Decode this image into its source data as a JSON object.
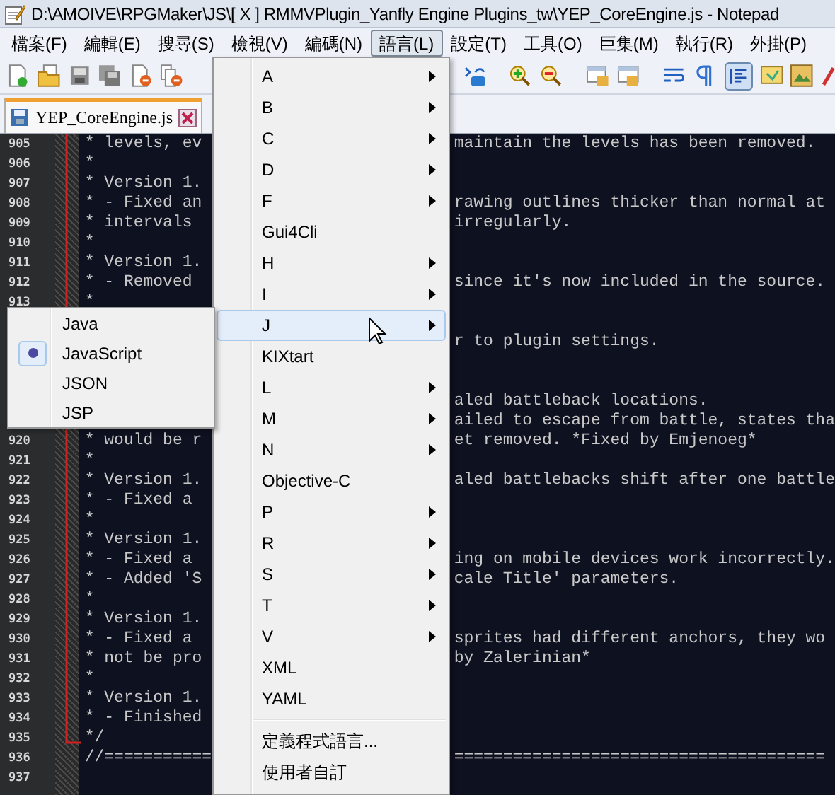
{
  "window": {
    "title": "D:\\AMOIVE\\RPGMaker\\JS\\[ X ] RMMVPlugin_Yanfly Engine Plugins_tw\\YEP_CoreEngine.js - Notepad"
  },
  "menu_bar": [
    {
      "label": "檔案(F)",
      "selected": false
    },
    {
      "label": "編輯(E)",
      "selected": false
    },
    {
      "label": "搜尋(S)",
      "selected": false
    },
    {
      "label": "檢視(V)",
      "selected": false
    },
    {
      "label": "編碼(N)",
      "selected": false
    },
    {
      "label": "語言(L)",
      "selected": true
    },
    {
      "label": "設定(T)",
      "selected": false
    },
    {
      "label": "工具(O)",
      "selected": false
    },
    {
      "label": "巨集(M)",
      "selected": false
    },
    {
      "label": "執行(R)",
      "selected": false
    },
    {
      "label": "外掛(P)",
      "selected": false
    }
  ],
  "tab": {
    "label": "YEP_CoreEngine.js"
  },
  "editor": {
    "lines": [
      {
        "kind": "code",
        "number": "905",
        "left": "* levels, ev",
        "right": "maintain the levels has been removed."
      },
      {
        "kind": "code",
        "number": "906",
        "left": "*"
      },
      {
        "kind": "code",
        "number": "907",
        "left": "* Version 1."
      },
      {
        "kind": "code",
        "number": "908",
        "left": "* - Fixed an",
        "right": "rawing outlines thicker than normal at"
      },
      {
        "kind": "code",
        "number": "909",
        "left": "* intervals",
        "right": "irregularly."
      },
      {
        "kind": "code",
        "number": "910",
        "left": "*"
      },
      {
        "kind": "code",
        "number": "911",
        "left": "* Version 1."
      },
      {
        "kind": "code",
        "number": "912",
        "left": "* - Removed",
        "right": "since it's now included in the source."
      },
      {
        "kind": "code",
        "number": "913",
        "left": "*"
      },
      {
        "kind": "covered"
      },
      {
        "kind": "code",
        "right": "r to plugin settings."
      },
      {
        "kind": "covered"
      },
      {
        "kind": "covered"
      },
      {
        "kind": "code",
        "right": "aled battleback locations."
      },
      {
        "kind": "code",
        "right": "ailed to escape from battle, states tha"
      },
      {
        "kind": "code",
        "number": "920",
        "left": "* would be r",
        "right": "et removed. *Fixed by Emjenoeg*"
      },
      {
        "kind": "code",
        "number": "921",
        "left": "*"
      },
      {
        "kind": "code",
        "number": "922",
        "left": "* Version 1.",
        "right": "aled battlebacks shift after one battle"
      },
      {
        "kind": "code",
        "number": "923",
        "left": "* - Fixed a"
      },
      {
        "kind": "code",
        "number": "924",
        "left": "*"
      },
      {
        "kind": "code",
        "number": "925",
        "left": "* Version 1."
      },
      {
        "kind": "code",
        "number": "926",
        "left": "* - Fixed a",
        "right": "ing on mobile devices work incorrectly."
      },
      {
        "kind": "code",
        "number": "927",
        "left": "* - Added 'S",
        "right": "cale Title' parameters."
      },
      {
        "kind": "code",
        "number": "928",
        "left": "*"
      },
      {
        "kind": "code",
        "number": "929",
        "left": "* Version 1."
      },
      {
        "kind": "code",
        "number": "930",
        "left": "* - Fixed a",
        "right": "sprites had different anchors, they wo"
      },
      {
        "kind": "code",
        "number": "931",
        "left": "* not be pro",
        "right": "by Zalerinian*"
      },
      {
        "kind": "code",
        "number": "932",
        "left": "*"
      },
      {
        "kind": "code",
        "number": "933",
        "left": "* Version 1."
      },
      {
        "kind": "code",
        "number": "934",
        "left": "* - Finished"
      },
      {
        "kind": "code",
        "number": "935",
        "left": "*/"
      },
      {
        "kind": "code",
        "number": "936",
        "left": "//===========",
        "right": "======================================"
      },
      {
        "kind": "code",
        "number": "937"
      }
    ]
  },
  "language_menu": {
    "items": [
      {
        "label": "A",
        "has_submenu": true,
        "highlighted": false
      },
      {
        "label": "B",
        "has_submenu": true,
        "highlighted": false
      },
      {
        "label": "C",
        "has_submenu": true,
        "highlighted": false
      },
      {
        "label": "D",
        "has_submenu": true,
        "highlighted": false
      },
      {
        "label": "F",
        "has_submenu": true,
        "highlighted": false
      },
      {
        "label": "Gui4Cli",
        "has_submenu": false,
        "highlighted": false
      },
      {
        "label": "H",
        "has_submenu": true,
        "highlighted": false
      },
      {
        "label": "I",
        "has_submenu": true,
        "highlighted": false
      },
      {
        "label": "J",
        "has_submenu": true,
        "highlighted": true
      },
      {
        "label": "KIXtart",
        "has_submenu": false,
        "highlighted": false
      },
      {
        "label": "L",
        "has_submenu": true,
        "highlighted": false
      },
      {
        "label": "M",
        "has_submenu": true,
        "highlighted": false
      },
      {
        "label": "N",
        "has_submenu": true,
        "highlighted": false
      },
      {
        "label": "Objective-C",
        "has_submenu": false,
        "highlighted": false
      },
      {
        "label": "P",
        "has_submenu": true,
        "highlighted": false
      },
      {
        "label": "R",
        "has_submenu": true,
        "highlighted": false
      },
      {
        "label": "S",
        "has_submenu": true,
        "highlighted": false
      },
      {
        "label": "T",
        "has_submenu": true,
        "highlighted": false
      },
      {
        "label": "V",
        "has_submenu": true,
        "highlighted": false
      },
      {
        "label": "XML",
        "has_submenu": false,
        "highlighted": false
      },
      {
        "label": "YAML",
        "has_submenu": false,
        "highlighted": false
      }
    ],
    "footer_items": [
      {
        "label": "定義程式語言..."
      },
      {
        "label": "使用者自訂"
      }
    ]
  },
  "j_submenu": {
    "items": [
      {
        "label": "Java",
        "checked": false
      },
      {
        "label": "JavaScript",
        "checked": true
      },
      {
        "label": "JSON",
        "checked": false
      },
      {
        "label": "JSP",
        "checked": false
      }
    ]
  }
}
